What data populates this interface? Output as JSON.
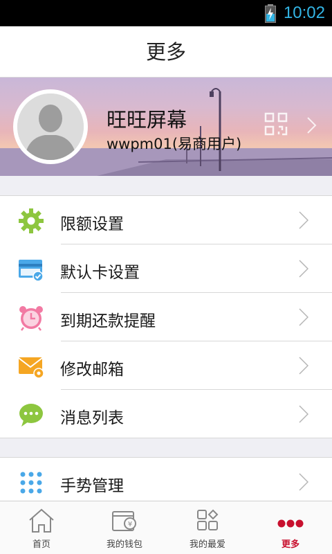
{
  "status_bar": {
    "time": "10:02"
  },
  "header": {
    "title": "更多"
  },
  "profile": {
    "name": "旺旺屏幕",
    "account": "wwpm01(易商用户)"
  },
  "menu_group_1": [
    {
      "label": "限额设置",
      "icon": "gear-icon",
      "color": "#8dc63f"
    },
    {
      "label": "默认卡设置",
      "icon": "card-icon",
      "color": "#4aa8e8"
    },
    {
      "label": "到期还款提醒",
      "icon": "alarm-clock-icon",
      "color": "#f27aa3"
    },
    {
      "label": "修改邮箱",
      "icon": "mail-gear-icon",
      "color": "#f5a623"
    },
    {
      "label": "消息列表",
      "icon": "chat-bubble-icon",
      "color": "#8dc63f"
    }
  ],
  "menu_group_2": [
    {
      "label": "手势管理",
      "icon": "gesture-dots-icon",
      "color": "#4aa8e8"
    }
  ],
  "bottom_nav": [
    {
      "label": "首页",
      "icon": "home-icon"
    },
    {
      "label": "我的钱包",
      "icon": "wallet-icon"
    },
    {
      "label": "我的最爱",
      "icon": "favorites-grid-icon"
    },
    {
      "label": "更多",
      "icon": "more-dots-icon",
      "active": true
    }
  ],
  "accent_color": "#c8102e"
}
